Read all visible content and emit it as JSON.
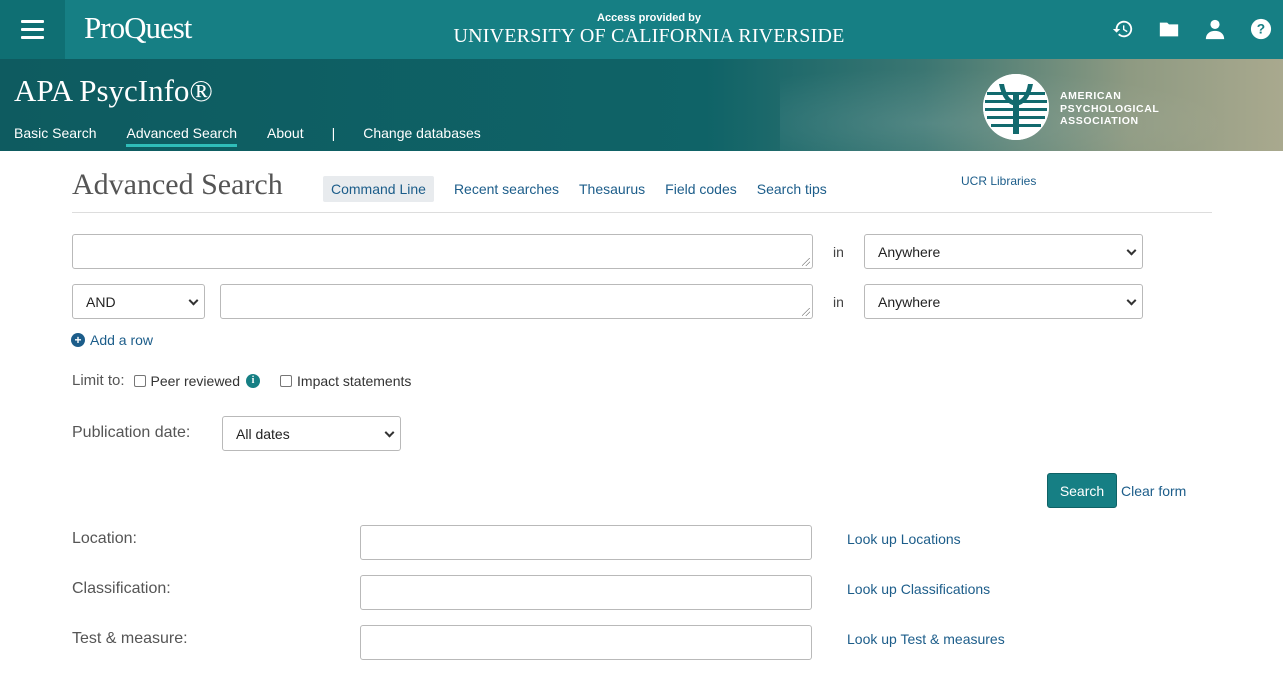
{
  "header": {
    "brand": "ProQuest",
    "access_label": "Access provided by",
    "institution": "UNIVERSITY OF CALIFORNIA RIVERSIDE",
    "icons": [
      "menu-icon",
      "history-icon",
      "folder-icon",
      "user-icon",
      "help-icon"
    ]
  },
  "database": {
    "title": "APA PsycInfo®",
    "nav": [
      "Basic Search",
      "Advanced Search",
      "About",
      "|",
      "Change databases"
    ],
    "active_nav": "Advanced Search",
    "publisher_lines": [
      "AMERICAN",
      "PSYCHOLOGICAL",
      "ASSOCIATION"
    ]
  },
  "page": {
    "title": "Advanced Search",
    "subnav": [
      "Command Line",
      "Recent searches",
      "Thesaurus",
      "Field codes",
      "Search tips"
    ],
    "library_link": "UCR Libraries"
  },
  "search_rows": [
    {
      "operator": "",
      "value": "",
      "in_label": "in",
      "field": "Anywhere"
    },
    {
      "operator": "AND",
      "value": "",
      "in_label": "in",
      "field": "Anywhere"
    }
  ],
  "add_row": "Add a row",
  "limits": {
    "label": "Limit to:",
    "options": [
      {
        "label": "Peer reviewed",
        "checked": false
      },
      {
        "label": "Impact statements",
        "checked": false
      }
    ]
  },
  "publication_date": {
    "label": "Publication date:",
    "value": "All dates"
  },
  "actions": {
    "search": "Search",
    "clear": "Clear form"
  },
  "lookup_fields": [
    {
      "label": "Location:",
      "value": "",
      "link": "Look up Locations"
    },
    {
      "label": "Classification:",
      "value": "",
      "link": "Look up Classifications"
    },
    {
      "label": "Test & measure:",
      "value": "",
      "link": "Look up Test & measures"
    }
  ],
  "colors": {
    "brand_teal": "#167f84",
    "link_blue": "#1c5d8a",
    "active_underline": "#2fbdb9"
  }
}
